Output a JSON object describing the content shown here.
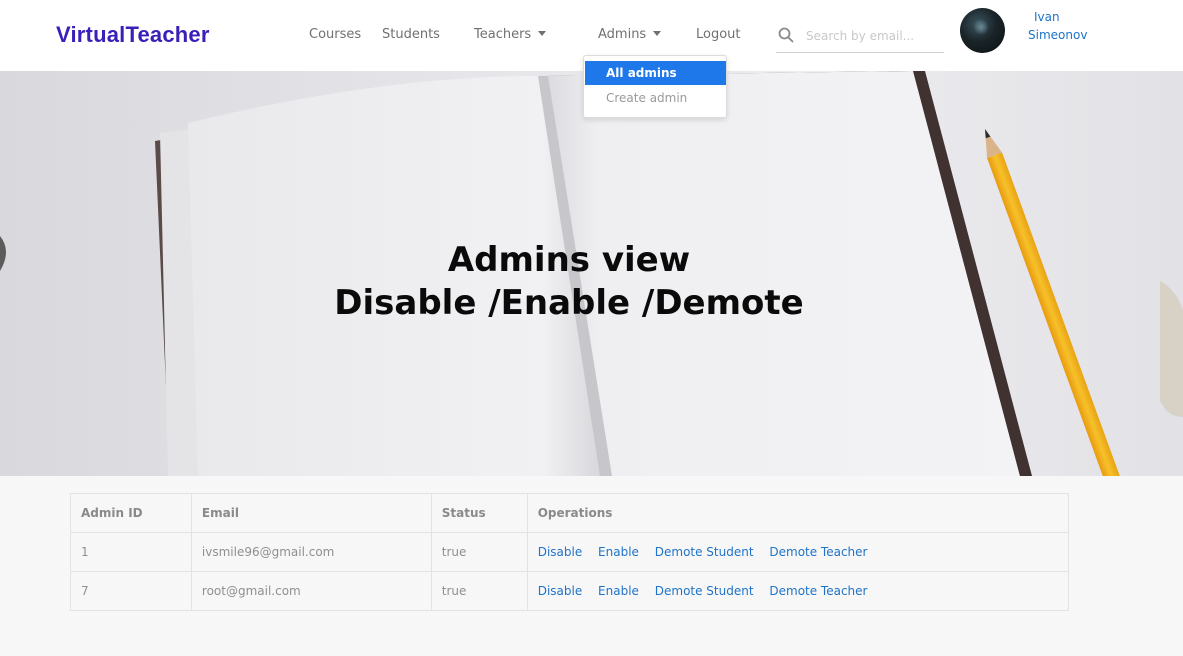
{
  "brand": "VirtualTeacher",
  "nav": {
    "courses": "Courses",
    "students": "Students",
    "teachers": "Teachers",
    "admins": "Admins",
    "logout": "Logout"
  },
  "search": {
    "placeholder": "Search by email..."
  },
  "user": {
    "first_name": "Ivan",
    "last_name": "Simeonov"
  },
  "admins_menu": {
    "items": [
      "All admins",
      "Create admin"
    ],
    "active_index": 0
  },
  "hero": {
    "line1": "Admins view",
    "line2": "Disable /Enable /Demote"
  },
  "table": {
    "headers": [
      "Admin ID",
      "Email",
      "Status",
      "Operations"
    ],
    "operations": [
      "Disable",
      "Enable",
      "Demote Student",
      "Demote Teacher"
    ],
    "rows": [
      {
        "id": "1",
        "email": "ivsmile96@gmail.com",
        "status": "true"
      },
      {
        "id": "7",
        "email": "root@gmail.com",
        "status": "true"
      }
    ]
  },
  "colors": {
    "brand": "#3a1fb8",
    "link": "#1f73c8",
    "dropdown_active": "#1e78ea",
    "pencil": "#f5b51f"
  },
  "icons": [
    "search-icon",
    "chevron-down-icon",
    "avatar"
  ]
}
